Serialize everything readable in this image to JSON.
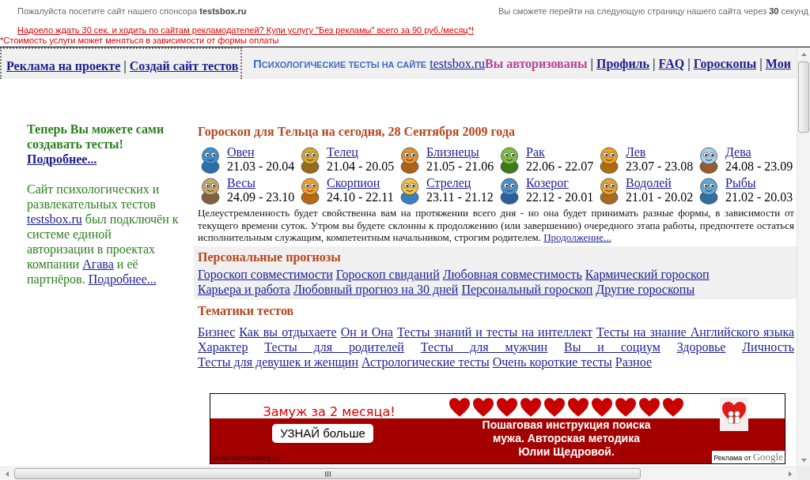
{
  "sponsor_bar": {
    "notice": "Пожалуйста посетите сайт нашего спонсора **testsbox.ru**",
    "countdown": "Вы сможете перейти на следующую страницу нашего сайта через **30** секунд",
    "offer_link": "Надоело ждать 30 сек. и ходить по сайтам рекламодателей? Купи услугу \"Без рекламы\" всего за 90 руб./месяц*!",
    "footnote": "*Стоимость услуги может меняться в зависимости от формы оплаты"
  },
  "header": {
    "left_items": [
      {
        "kind": "link",
        "text": "Реклама на проекте"
      },
      {
        "kind": "separator",
        "text": "|"
      },
      {
        "kind": "link",
        "text": "Создай сайт тестов"
      }
    ],
    "site_caption": "ПСИХОЛОГИЧЕСКИЕ ТЕСТЫ НА САЙТЕ",
    "site_link": "testsbox.ru",
    "nav_items": [
      {
        "kind": "status",
        "text": "Вы авторизованы"
      },
      {
        "kind": "separator",
        "text": "|"
      },
      {
        "kind": "link",
        "text": "Профиль"
      },
      {
        "kind": "separator",
        "text": "|"
      },
      {
        "kind": "link",
        "text": "FAQ"
      },
      {
        "kind": "separator",
        "text": "|"
      },
      {
        "kind": "link",
        "text": "Гороскопы"
      },
      {
        "kind": "separator",
        "text": "|"
      },
      {
        "kind": "link",
        "text": "Мои"
      }
    ]
  },
  "sidebar": {
    "promo_title": "Теперь Вы можете сами создавать тесты!",
    "promo_link": "Подробнее...",
    "info_parts": [
      {
        "kind": "text",
        "text": "Сайт психологических и развлекательных тестов"
      },
      {
        "kind": "link",
        "text": "testsbox.ru"
      },
      {
        "kind": "text",
        "text": "был подключён к системе единой авторизации в проектах компании"
      },
      {
        "kind": "link",
        "text": "Агава"
      },
      {
        "kind": "text",
        "text": "и её партнёров."
      },
      {
        "kind": "link",
        "text": "Подробнее..."
      }
    ]
  },
  "horoscope": {
    "title": "Гороскоп для Тельца на сегодня, 28 Сентября 2009 года",
    "signs": [
      {
        "name": "Овен",
        "dates": "21.03 - 20.04"
      },
      {
        "name": "Телец",
        "dates": "21.04 - 20.05"
      },
      {
        "name": "Близнецы",
        "dates": "21.05 - 21.06"
      },
      {
        "name": "Рак",
        "dates": "22.06 - 22.07"
      },
      {
        "name": "Лев",
        "dates": "23.07 - 23.08"
      },
      {
        "name": "Дева",
        "dates": "24.08 - 23.09"
      },
      {
        "name": "Весы",
        "dates": "24.09 - 23.10"
      },
      {
        "name": "Скорпион",
        "dates": "24.10 - 22.11"
      },
      {
        "name": "Стрелец",
        "dates": "23.11 - 21.12"
      },
      {
        "name": "Козерог",
        "dates": "22.12 - 20.01"
      },
      {
        "name": "Водолей",
        "dates": "21.01 - 20.02"
      },
      {
        "name": "Рыбы",
        "dates": "21.02 - 20.03"
      }
    ],
    "forecast_parts": [
      {
        "kind": "text",
        "text": "Целеустремленность будет свойственна вам на протяжении всего дня - но она будет принимать разные формы, в зависимости от текущего времени суток. Утром вы будете склонны к продолжению (или завершению) очередного этапа работы, предпочтете остаться исполнительным служащим, компетентным начальником, строгим родителем."
      },
      {
        "kind": "link",
        "text": "Продолжение..."
      }
    ]
  },
  "personal_forecasts": {
    "title": "Персональные прогнозы",
    "links": [
      "Гороскоп совместимости",
      "Гороскоп свиданий",
      "Любовная совместимость",
      "Кармический гороскоп",
      "Карьера и работа",
      "Любовный прогноз на 30 дней",
      "Персональный гороскоп",
      "Другие гороскопы"
    ]
  },
  "test_topics": {
    "title": "Тематики тестов",
    "links": [
      "Бизнес",
      "Как вы отдыхаете",
      "Он и Она",
      "Тесты знаний и тесты на интеллект",
      "Тесты на знание Английского языка",
      "Характер",
      "Тесты для родителей",
      "Тесты для мужчин",
      "Вы и социум",
      "Здоровье",
      "Личность",
      "Тесты для девушек и женщин",
      "Астрологические тесты",
      "Очень короткие тесты",
      "Разное"
    ]
  },
  "ad_banner": {
    "headline": "Замуж за 2 месяца!",
    "button": "УЗНАЙ больше",
    "description": "Пошаговая инструкция поиска мужа. Авторская методика Юлии Щедровой.",
    "url": "www.hochu-zamuj.ru",
    "ad_label": "Реклама от",
    "provider": "Google"
  }
}
